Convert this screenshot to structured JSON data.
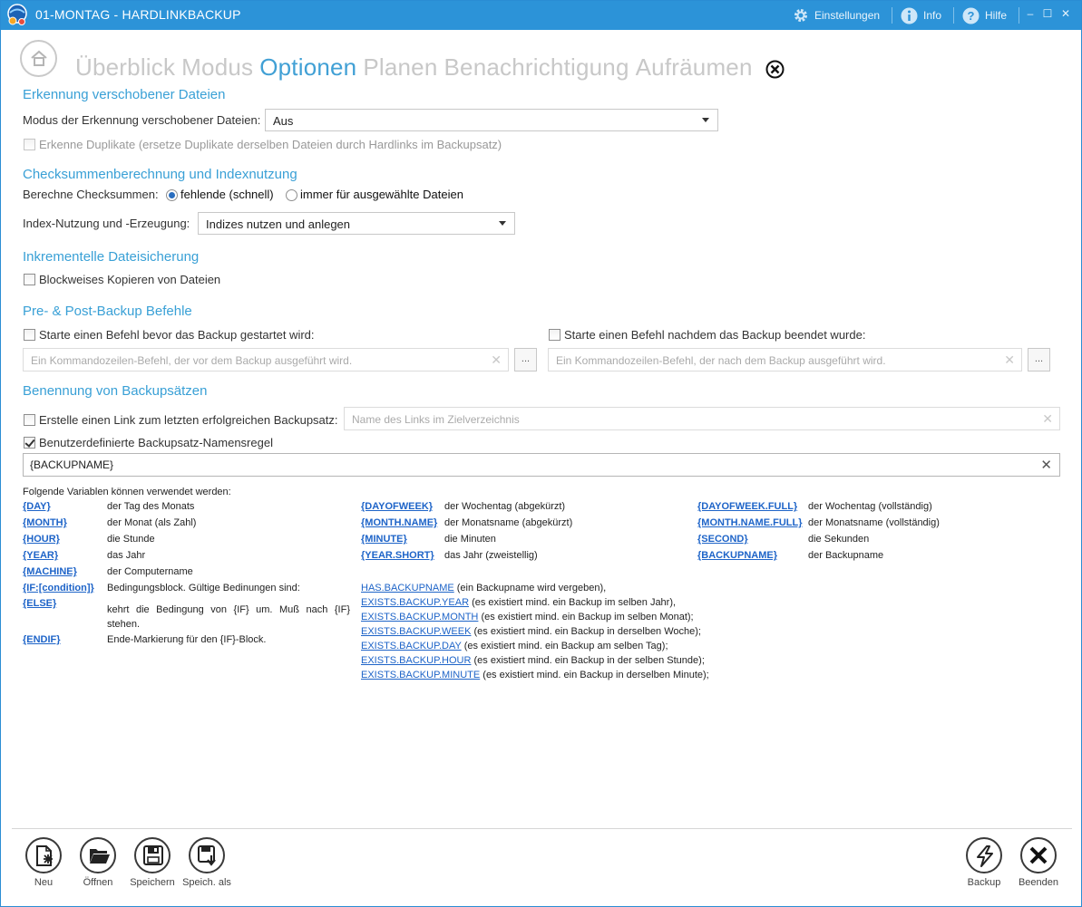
{
  "window": {
    "title": "01-MONTAG - HARDLINKBACKUP"
  },
  "titlebar": {
    "settings_label": "Einstellungen",
    "info_label": "Info",
    "help_label": "Hilfe",
    "minimize_glyph": "–",
    "maximize_glyph": "☐",
    "close_glyph": "✕",
    "accent": "#2c93d8"
  },
  "nav": {
    "tabs": [
      "Überblick",
      "Modus",
      "Optionen",
      "Planen",
      "Benachrichtigung",
      "Aufräumen"
    ],
    "active_tab": "Optionen",
    "active_color": "#41a0d5"
  },
  "moved_files": {
    "title": "Erkennung verschobener Dateien",
    "mode_label": "Modus der Erkennung verschobener Dateien:",
    "mode_value": "Aus",
    "duplicates_label": "Erkenne Duplikate (ersetze Duplikate derselben Dateien durch Hardlinks im Backupsatz)",
    "duplicates_checked": false,
    "duplicates_enabled": false
  },
  "checksums": {
    "title": "Checksummenberechnung und Indexnutzung",
    "calc_label": "Berechne Checksummen:",
    "radio_missing": "fehlende (schnell)",
    "radio_always": "immer für ausgewählte Dateien",
    "selected": "fehlende (schnell)",
    "index_label": "Index-Nutzung und -Erzeugung:",
    "index_value": "Indizes nutzen und anlegen"
  },
  "incremental": {
    "title": "Inkrementelle Dateisicherung",
    "blockwise_label": "Blockweises Kopieren von Dateien",
    "blockwise_checked": false
  },
  "prepost": {
    "title": "Pre- & Post-Backup Befehle",
    "pre_label": "Starte einen Befehl bevor das Backup gestartet wird:",
    "pre_placeholder": "Ein Kommandozeilen-Befehl, der vor dem Backup ausgeführt wird.",
    "post_label": "Starte einen Befehl nachdem das Backup beendet wurde:",
    "post_placeholder": "Ein Kommandozeilen-Befehl, der nach dem Backup ausgeführt wird.",
    "browse_glyph": "...",
    "clear_glyph": "✕"
  },
  "naming": {
    "title": "Benennung von Backupsätzen",
    "link_label": "Erstelle einen Link zum letzten erfolgreichen Backupsatz:",
    "link_placeholder": "Name des Links im Zielverzeichnis",
    "link_checked": false,
    "custom_label": "Benutzerdefinierte Backupsatz-Namensregel",
    "custom_checked": true,
    "name_value": "{BACKUPNAME}",
    "clear_glyph": "✕"
  },
  "variables": {
    "intro": "Folgende Variablen können verwendet werden:",
    "col1": [
      {
        "name": "{DAY}",
        "desc": "der Tag des Monats"
      },
      {
        "name": "{MONTH}",
        "desc": "der Monat (als Zahl)"
      },
      {
        "name": "{HOUR}",
        "desc": "die Stunde"
      },
      {
        "name": "{YEAR}",
        "desc": "das Jahr"
      },
      {
        "name": "{MACHINE}",
        "desc": "der Computername"
      },
      {
        "name": "{IF:[condition]}",
        "desc": "Bedingungsblock. Gültige Bedinungen sind:"
      },
      {
        "name": "{ELSE}",
        "desc": "kehrt die Bedingung von {IF} um. Muß nach {IF} stehen."
      },
      {
        "name": "{ENDIF}",
        "desc": "Ende-Markierung für den {IF}-Block."
      }
    ],
    "col2": [
      {
        "name": "{DAYOFWEEK}",
        "desc": "der Wochentag (abgekürzt)"
      },
      {
        "name": "{MONTH.NAME}",
        "desc": "der Monatsname (abgekürzt)"
      },
      {
        "name": "{MINUTE}",
        "desc": "die Minuten"
      },
      {
        "name": "{YEAR.SHORT}",
        "desc": "das Jahr (zweistellig)"
      }
    ],
    "col3": [
      {
        "name": "{DAYOFWEEK.FULL}",
        "desc": "der Wochentag (vollständig)"
      },
      {
        "name": "{MONTH.NAME.FULL}",
        "desc": "der Monatsname (vollständig)"
      },
      {
        "name": "{SECOND}",
        "desc": "die Sekunden"
      },
      {
        "name": "{BACKUPNAME}",
        "desc": "der Backupname"
      }
    ],
    "conditions": [
      {
        "name": "HAS.BACKUPNAME",
        "desc": "(ein Backupname wird vergeben),"
      },
      {
        "name": "EXISTS.BACKUP.YEAR",
        "desc": "(es existiert mind. ein Backup im selben Jahr),"
      },
      {
        "name": "EXISTS.BACKUP.MONTH",
        "desc": "(es existiert mind. ein Backup im selben Monat);"
      },
      {
        "name": "EXISTS.BACKUP.WEEK",
        "desc": "(es existiert mind. ein Backup in derselben Woche);"
      },
      {
        "name": "EXISTS.BACKUP.DAY",
        "desc": "(es existiert mind. ein Backup am selben Tag);"
      },
      {
        "name": "EXISTS.BACKUP.HOUR",
        "desc": "(es existiert mind. ein Backup in der selben Stunde);"
      },
      {
        "name": "EXISTS.BACKUP.MINUTE",
        "desc": "(es existiert mind. ein Backup in derselben Minute);"
      }
    ]
  },
  "toolbar": {
    "new_label": "Neu",
    "open_label": "Öffnen",
    "save_label": "Speichern",
    "save_as_label": "Speich. als",
    "backup_label": "Backup",
    "exit_label": "Beenden"
  }
}
